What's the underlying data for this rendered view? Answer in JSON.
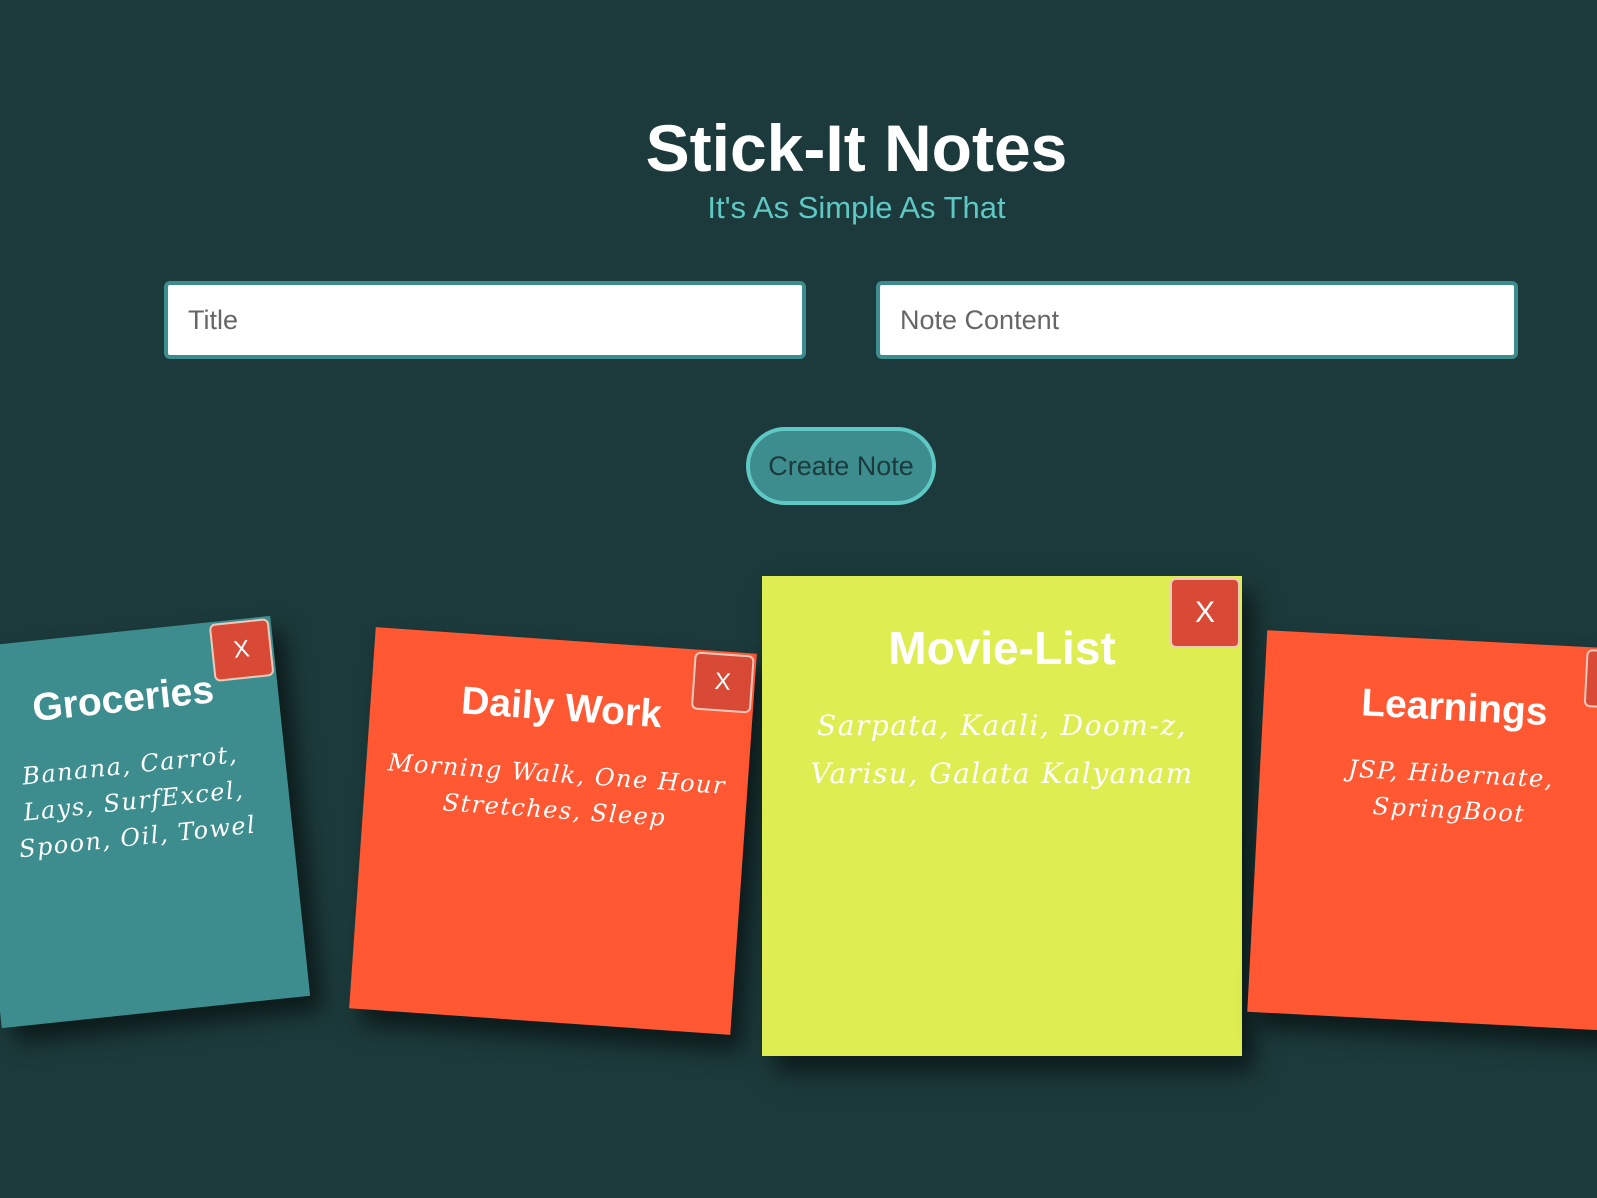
{
  "header": {
    "title": "Stick-It Notes",
    "subtitle": "It's As Simple As That"
  },
  "form": {
    "title_placeholder": "Title",
    "title_value": "",
    "content_placeholder": "Note Content",
    "content_value": "",
    "create_label": "Create Note"
  },
  "notes": [
    {
      "title": "Groceries",
      "content": "Banana, Carrot, Lays, SurfExcel, Spoon, Oil, Towel",
      "close_label": "X",
      "color": "#3d8d8e"
    },
    {
      "title": "Daily Work",
      "content": "Morning Walk, One Hour Stretches, Sleep",
      "close_label": "X",
      "color": "#ff5833"
    },
    {
      "title": "Movie-List",
      "content": "Sarpata, Kaali, Doom-z, Varisu, Galata Kalyanam",
      "close_label": "X",
      "color": "#deed52"
    },
    {
      "title": "Learnings",
      "content": "JSP, Hibernate, SpringBoot",
      "close_label": "X",
      "color": "#ff5833"
    }
  ],
  "colors": {
    "background": "#1c3a3b",
    "accent": "#5ec9c4",
    "teal": "#3d8d8e",
    "close_button": "#d84a35"
  }
}
